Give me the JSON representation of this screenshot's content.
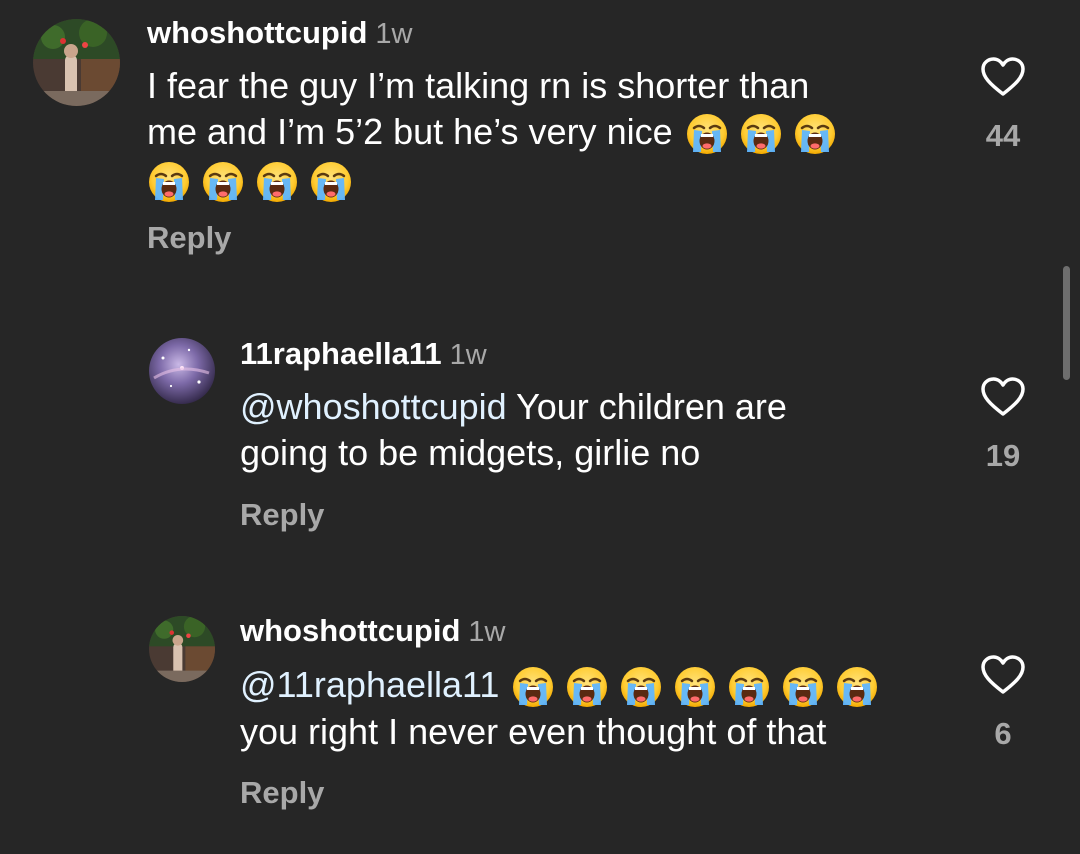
{
  "comments": [
    {
      "username": "whoshottcupid",
      "time": "1w",
      "text_line1": "I fear the guy I’m talking rn is shorter than",
      "text_line2": "me and I’m 5’2 but he’s very nice",
      "emoji": "loudly-crying-face",
      "reply_label": "Reply",
      "like_count": "44"
    },
    {
      "username": "11raphaella11",
      "time": "1w",
      "mention": "@whoshottcupid",
      "text_line1": " Your children are",
      "text_line2": "going to be midgets, girlie no",
      "reply_label": "Reply",
      "like_count": "19"
    },
    {
      "username": "whoshottcupid",
      "time": "1w",
      "mention": "@11raphaella11",
      "text_line2": "you right I never even thought of that",
      "emoji": "loudly-crying-face",
      "reply_label": "Reply",
      "like_count": "6"
    }
  ],
  "colors": {
    "background": "#262626",
    "secondary_text": "#a8a8a8",
    "mention": "#e0f1ff"
  },
  "icons": {
    "like": "heart-outline-icon",
    "emoji": "loudly-crying-face-emoji"
  }
}
